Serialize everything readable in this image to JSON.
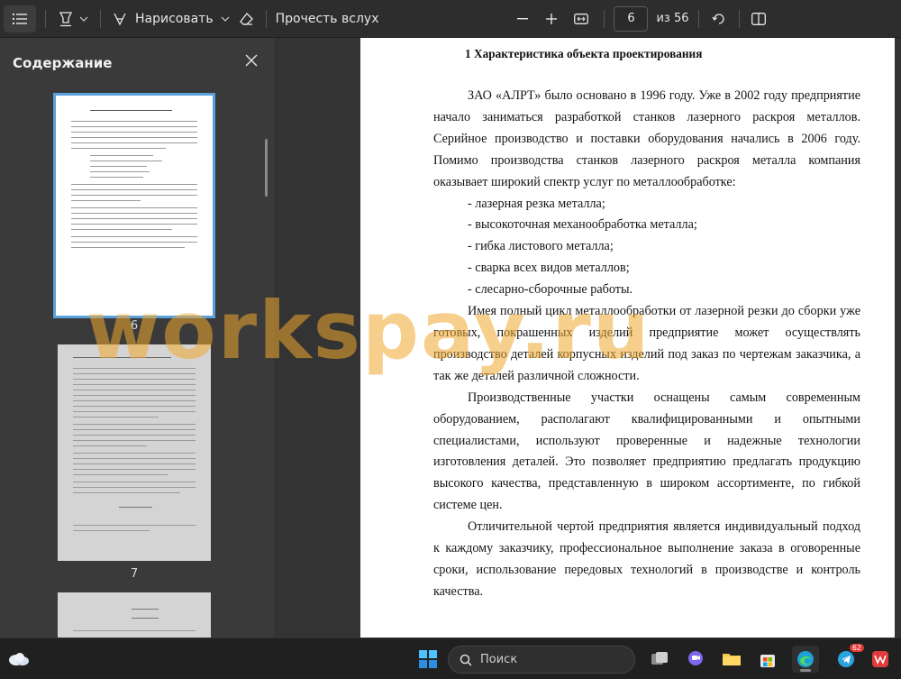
{
  "toolbar": {
    "draw_label": "Нарисовать",
    "read_aloud_label": "Прочесть вслух",
    "page_current": "6",
    "page_total": "из 56"
  },
  "sidebar": {
    "title": "Содержание",
    "thumbnails": [
      {
        "number": "6"
      },
      {
        "number": "7"
      }
    ]
  },
  "document": {
    "heading": "1 Характеристика объекта проектирования",
    "paragraphs": [
      "ЗАО «АЛРТ» было основано в 1996 году. Уже в 2002 году предприятие начало заниматься разработкой станков лазерного раскроя металлов. Серийное производство и поставки оборудования начались в 2006 году. Помимо производства станков лазерного раскроя металла компания оказывает широкий спектр услуг по металлообработке:",
      "- лазерная резка металла;",
      "- высокоточная механообработка металла;",
      "- гибка листового металла;",
      "- сварка всех видов металлов;",
      "- слесарно-сборочные работы.",
      "Имея полный цикл металлообработки от лазерной резки до сборки уже готовых, покрашенных изделий предприятие может осуществлять производство деталей корпусных изделий под заказ по чертежам заказчика, а так же деталей различной сложности.",
      "Производственные участки оснащены самым современным оборудованием, располагают квалифицированными и опытными специалистами, используют проверенные и надежные технологии изготовления деталей. Это позволяет предприятию предлагать продукцию высокого качества, представленную в широком ассортименте, по гибкой системе цен.",
      "Отличительной чертой предприятия является индивидуальный подход к каждому заказчику, профессиональное выполнение заказа в оговоренные сроки, использование передовых технологий в производстве и контроль качества."
    ]
  },
  "watermark": "workspay.ru",
  "taskbar": {
    "search_placeholder": "Поиск",
    "telegram_badge": "62"
  }
}
